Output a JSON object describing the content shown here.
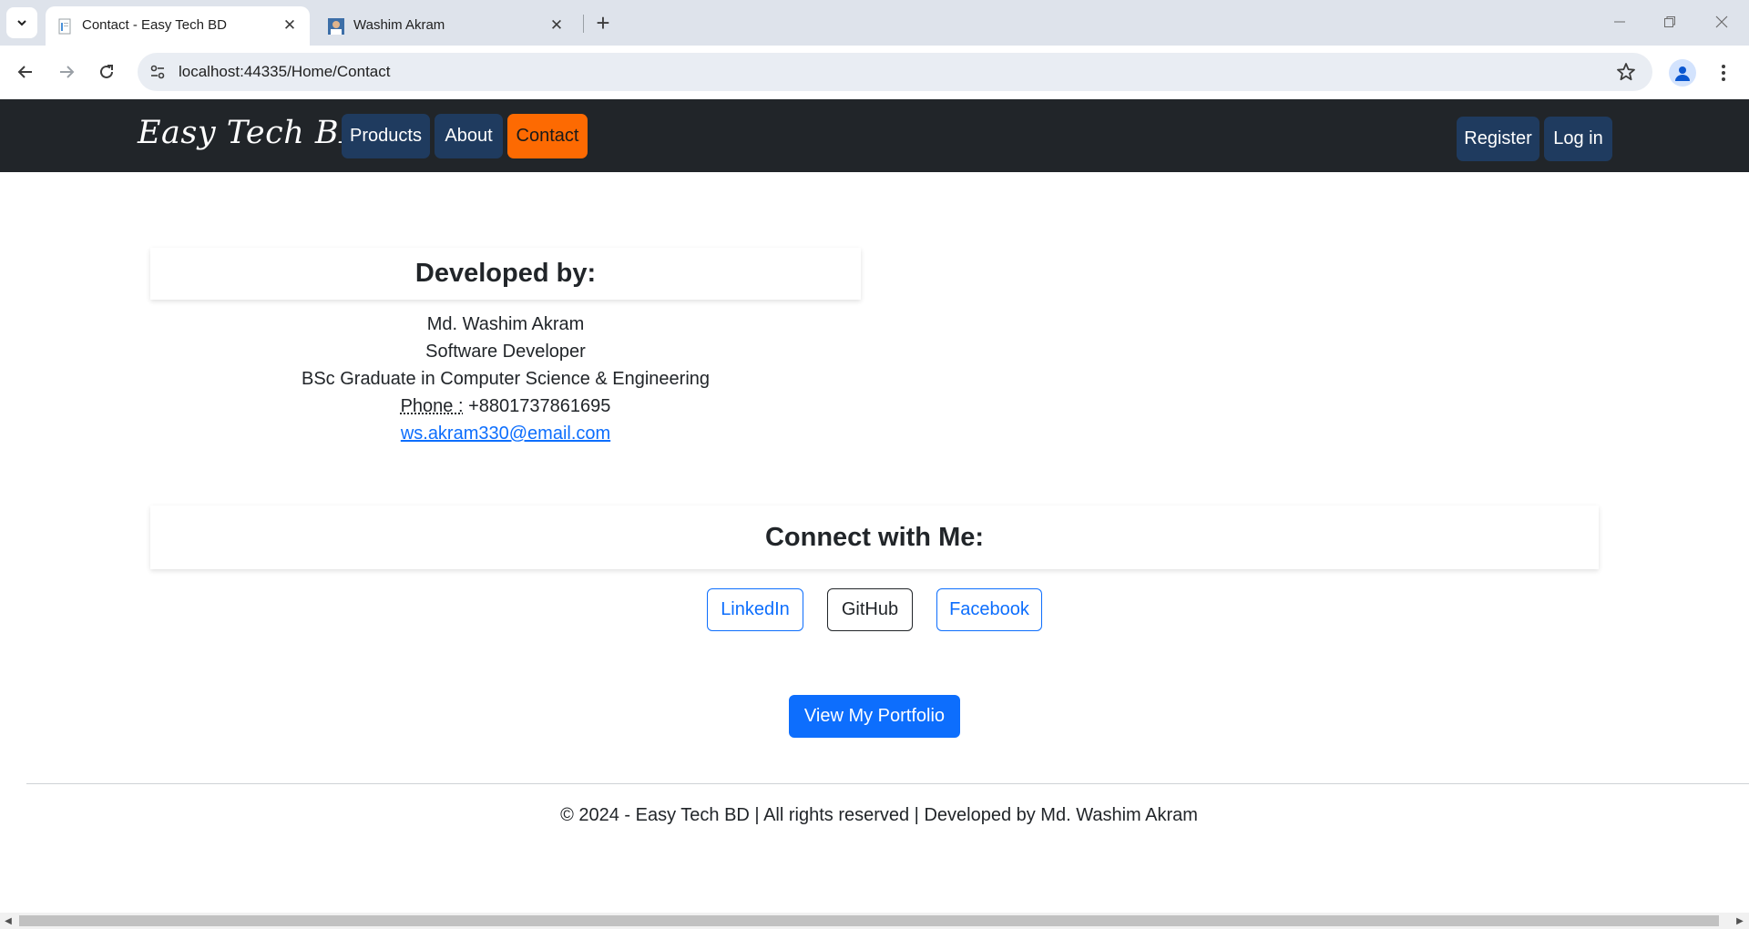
{
  "browser": {
    "tabs": [
      {
        "title": "Contact - Easy Tech BD",
        "active": true,
        "favicon": "document-icon"
      },
      {
        "title": "Washim Akram",
        "active": false,
        "favicon": "profile-photo-icon"
      }
    ],
    "url": "localhost:44335/Home/Contact"
  },
  "navbar": {
    "brand": "Easy Tech BD",
    "links": [
      {
        "label": "Products"
      },
      {
        "label": "About"
      },
      {
        "label": "Contact",
        "active": true
      }
    ],
    "auth": {
      "register": "Register",
      "login": "Log in"
    },
    "colors": {
      "background": "#212529",
      "link_bg": "#1f3b5f",
      "active_bg": "#fd6a02"
    }
  },
  "developer": {
    "heading": "Developed by:",
    "name": "Md. Washim Akram",
    "role": "Software Developer",
    "education": "BSc Graduate in Computer Science & Engineering",
    "phone_label": "Phone :",
    "phone": "+8801737861695",
    "email": "ws.akram330@email.com"
  },
  "connect": {
    "heading": "Connect with Me:",
    "buttons": [
      {
        "label": "LinkedIn"
      },
      {
        "label": "GitHub"
      },
      {
        "label": "Facebook"
      }
    ]
  },
  "portfolio_button": "View My Portfolio",
  "footer": {
    "text": "© 2024 - Easy Tech BD | All rights reserved | Developed by Md. Washim Akram"
  }
}
